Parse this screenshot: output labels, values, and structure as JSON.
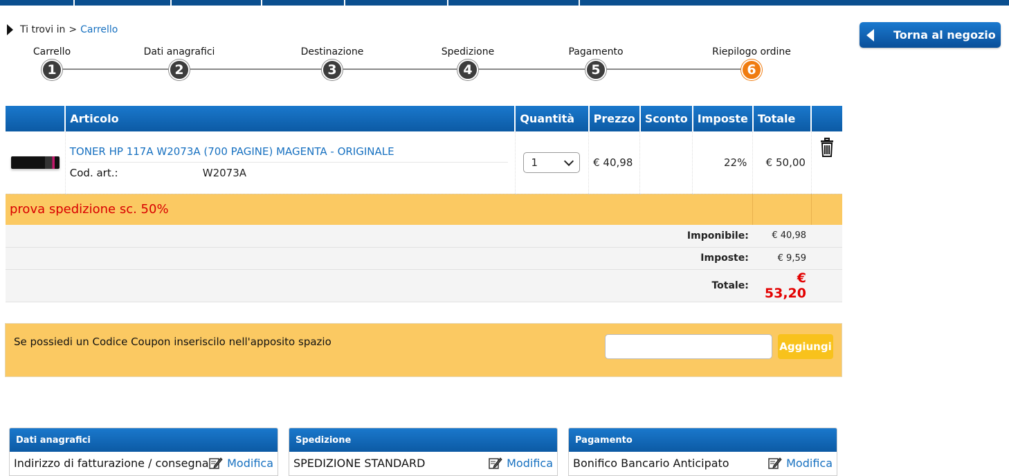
{
  "breadcrumb": {
    "prefix": "Ti trovi in",
    "separator": ">",
    "current": "Carrello"
  },
  "back_button": {
    "label": "Torna al negozio"
  },
  "steps": [
    {
      "label": "Carrello",
      "number": "1",
      "active": false
    },
    {
      "label": "Dati anagrafici",
      "number": "2",
      "active": false
    },
    {
      "label": "Destinazione",
      "number": "3",
      "active": false
    },
    {
      "label": "Spedizione",
      "number": "4",
      "active": false
    },
    {
      "label": "Pagamento",
      "number": "5",
      "active": false
    },
    {
      "label": "Riepilogo ordine",
      "number": "6",
      "active": true
    }
  ],
  "cart": {
    "headers": {
      "articolo": "Articolo",
      "quantita": "Quantità",
      "prezzo": "Prezzo",
      "sconto": "Sconto",
      "imposte": "Imposte",
      "totale": "Totale"
    },
    "item": {
      "name": "TONER HP 117A W2073A (700 PAGINE) MAGENTA - ORIGINALE",
      "code_label": "Cod. art.:",
      "code_value": "W2073A",
      "quantity": "1",
      "price": "€ 40,98",
      "discount": "",
      "tax": "22%",
      "total": "€ 50,00"
    },
    "promo_text": "prova spedizione sc. 50%",
    "summary": {
      "imponibile_label": "Imponibile:",
      "imponibile_value": "€ 40,98",
      "imposte_label": "Imposte:",
      "imposte_value": "€ 9,59",
      "totale_label": "Totale:",
      "totale_value": "€ 53,20"
    }
  },
  "coupon": {
    "text": "Se possiedi un Codice Coupon inseriscilo nell'apposito spazio",
    "value": "",
    "button": "Aggiungi"
  },
  "panels": [
    {
      "title": "Dati anagrafici",
      "content": "Indirizzo di fatturazione / consegna",
      "action": "Modifica"
    },
    {
      "title": "Spedizione",
      "content": "SPEDIZIONE STANDARD",
      "action": "Modifica"
    },
    {
      "title": "Pagamento",
      "content": "Bonifico Bancario Anticipato",
      "action": "Modifica"
    }
  ],
  "colors": {
    "primary_blue": "#0c5aa4",
    "accent_orange": "#f07c10",
    "promo_bg": "#fbc962",
    "total_red": "#e30000"
  },
  "icons": {
    "breadcrumb": "play-triangle-icon",
    "back": "back-arrow-icon",
    "delete": "trash-icon",
    "edit": "edit-pencil-icon",
    "select": "chevron-down-icon"
  }
}
